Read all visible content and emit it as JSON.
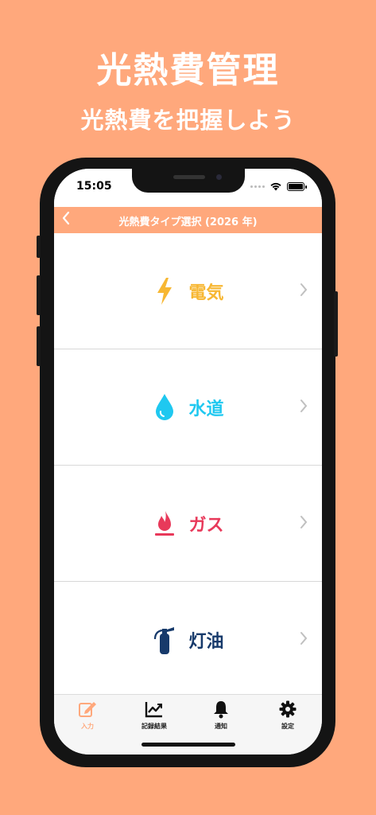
{
  "promo": {
    "title": "光熱費管理",
    "subtitle": "光熱費を把握しよう"
  },
  "status_bar": {
    "time": "15:05"
  },
  "nav": {
    "title": "光熱費タイプ選択 (2026 年)",
    "back_icon": "chevron-left-icon"
  },
  "utilities": [
    {
      "label": "電気",
      "icon": "lightning-icon",
      "color": "#F7B733"
    },
    {
      "label": "水道",
      "icon": "water-drop-icon",
      "color": "#1FC8F0"
    },
    {
      "label": "ガス",
      "icon": "flame-icon",
      "color": "#E8395A"
    },
    {
      "label": "灯油",
      "icon": "fire-extinguisher-icon",
      "color": "#173A6B"
    }
  ],
  "tabs": [
    {
      "label": "入力",
      "icon": "edit-icon",
      "active": true
    },
    {
      "label": "記録結果",
      "icon": "chart-icon",
      "active": false
    },
    {
      "label": "通知",
      "icon": "bell-icon",
      "active": false
    },
    {
      "label": "設定",
      "icon": "gear-icon",
      "active": false
    }
  ],
  "colors": {
    "accent": "#FFA87C",
    "tab_active": "#FFA87C",
    "tab_inactive": "#111111"
  }
}
